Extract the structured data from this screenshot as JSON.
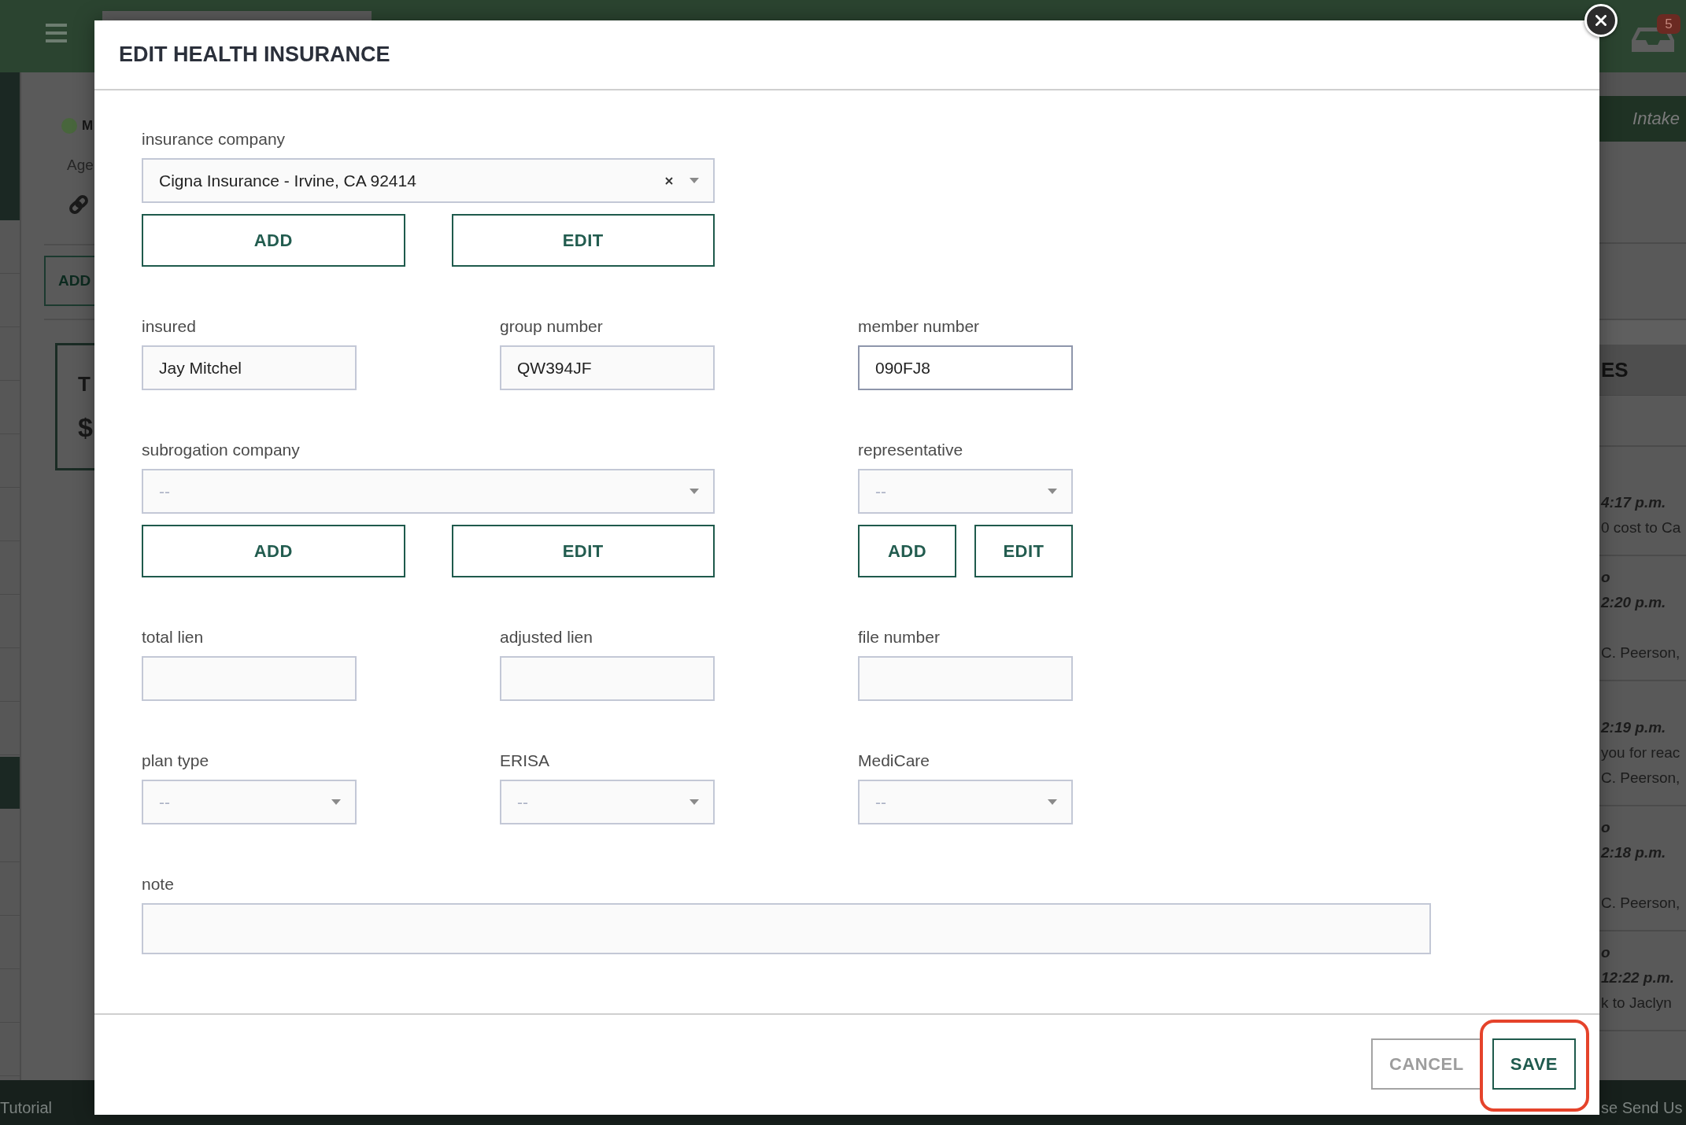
{
  "background": {
    "top_bar": {
      "notification_count": "5"
    },
    "profile": {
      "name": "M",
      "age_label": "Age",
      "add_button": "ADD",
      "card": {
        "title": "T",
        "amount": "$"
      }
    },
    "side_panel": {
      "tab": "Intake",
      "heading": "ES",
      "notes": [
        {
          "lines": [
            {
              "kind": "time",
              "text": "4:17 p.m."
            },
            {
              "kind": "body",
              "text": "0 cost to Ca"
            }
          ]
        },
        {
          "lines": [
            {
              "kind": "recipient",
              "text": "o"
            },
            {
              "kind": "time",
              "text": "2:20 p.m."
            },
            {
              "kind": "signature",
              "text": "C. Peerson,"
            }
          ]
        },
        {
          "lines": [
            {
              "kind": "time",
              "text": "2:19 p.m."
            },
            {
              "kind": "body",
              "text": "you for reac"
            },
            {
              "kind": "signature",
              "text": "C. Peerson,"
            }
          ]
        },
        {
          "lines": [
            {
              "kind": "recipient",
              "text": "o"
            },
            {
              "kind": "time",
              "text": "2:18 p.m."
            },
            {
              "kind": "signature",
              "text": "C. Peerson,"
            }
          ]
        },
        {
          "lines": [
            {
              "kind": "recipient",
              "text": "o"
            },
            {
              "kind": "time",
              "text": "12:22 p.m."
            },
            {
              "kind": "body",
              "text": "k to Jaclyn"
            }
          ]
        }
      ]
    },
    "footer": {
      "link": "Tutorial",
      "text": "se Send Us"
    }
  },
  "dialog": {
    "title": "EDIT HEALTH INSURANCE",
    "rows": [
      [
        {
          "kind": "company_picker",
          "label": "insurance company",
          "value": "Cigna Insurance - Irvine, CA 92414",
          "clearable": true,
          "buttons": [
            "ADD",
            "EDIT"
          ]
        }
      ],
      [
        {
          "kind": "text",
          "label": "insured",
          "value": "Jay Mitchel",
          "focused": false
        },
        {
          "kind": "text",
          "label": "group number",
          "value": "QW394JF",
          "focused": false
        },
        {
          "kind": "text",
          "label": "member number",
          "value": "090FJ8",
          "focused": true
        }
      ],
      [
        {
          "kind": "company_picker",
          "label": "subrogation company",
          "placeholder": "--",
          "clearable": false,
          "buttons": [
            "ADD",
            "EDIT"
          ]
        },
        "",
        {
          "kind": "person_picker",
          "label": "representative",
          "placeholder": "--",
          "buttons": [
            "ADD",
            "EDIT"
          ]
        }
      ],
      [
        {
          "kind": "text",
          "label": "total lien",
          "focused": false
        },
        {
          "kind": "text",
          "label": "adjusted lien",
          "focused": false
        },
        {
          "kind": "text",
          "label": "file number",
          "focused": false
        }
      ],
      [
        {
          "kind": "select",
          "label": "plan type",
          "placeholder": "--"
        },
        {
          "kind": "select",
          "label": "ERISA",
          "placeholder": "--"
        },
        {
          "kind": "select",
          "label": "MediCare",
          "placeholder": "--"
        }
      ],
      [
        {
          "kind": "note",
          "label": "note",
          "focused": false
        }
      ]
    ],
    "buttons": [
      {
        "label": "CANCEL",
        "kind": "secondary",
        "highlighted": false
      },
      {
        "label": "SAVE",
        "kind": "primary",
        "highlighted": true
      }
    ]
  }
}
